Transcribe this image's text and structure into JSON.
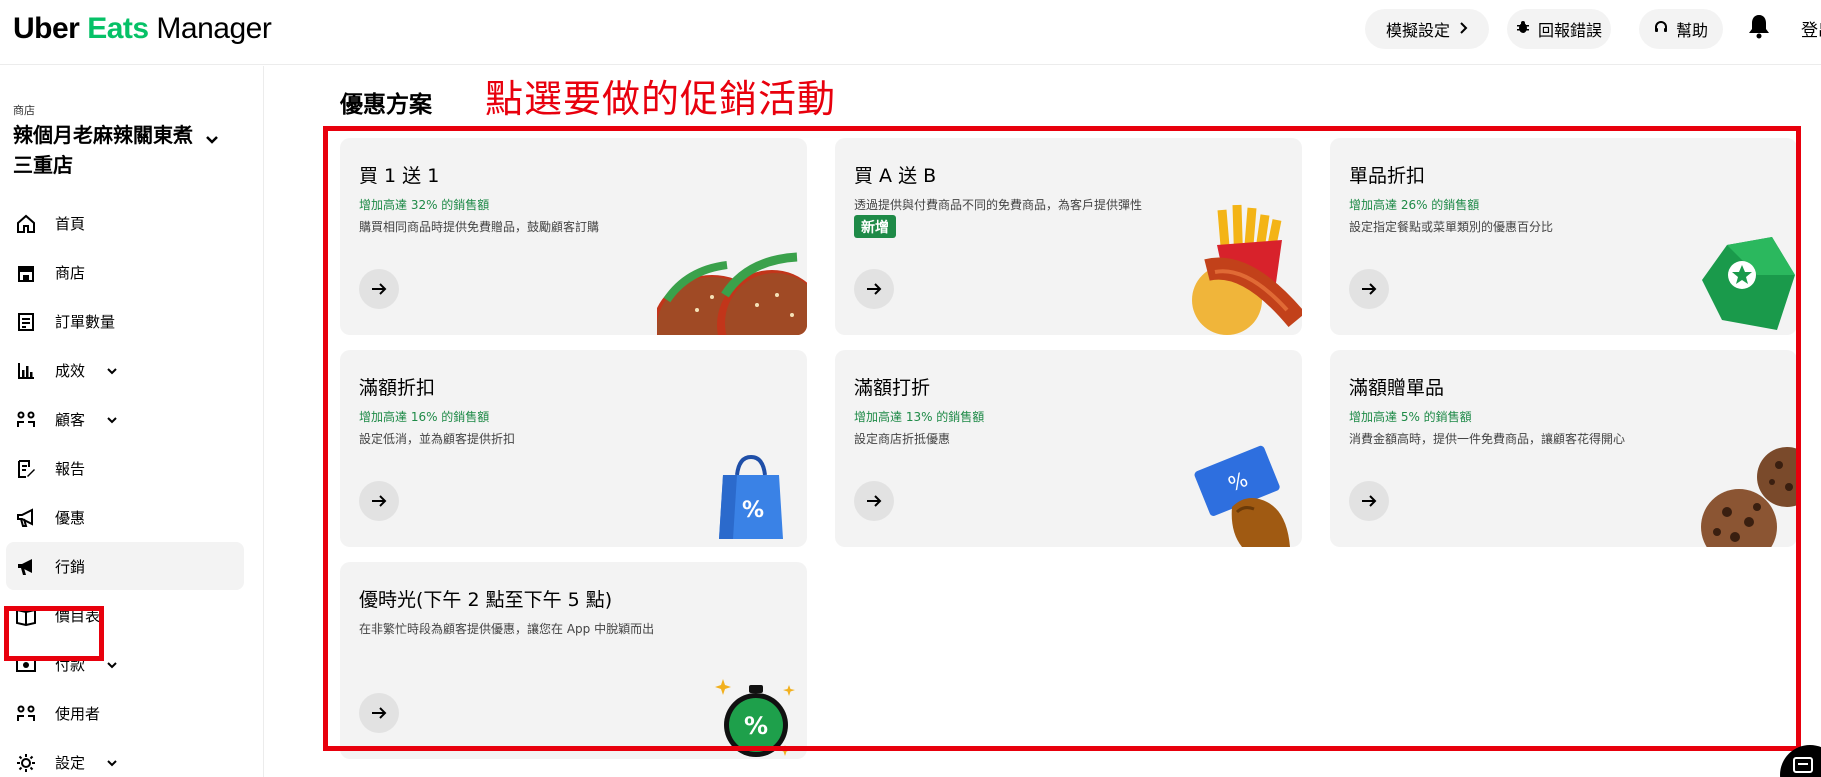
{
  "header": {
    "logo": {
      "uber": "Uber",
      "eats": "Eats",
      "manager": "Manager"
    },
    "simulate_label": "模擬設定",
    "report_bug_label": "回報錯誤",
    "help_label": "幫助",
    "logout_label": "登出"
  },
  "sidebar": {
    "store_label": "商店",
    "store_name": "辣個月老麻辣關東煮 三重店",
    "items": [
      {
        "label": "首頁",
        "icon": "home-icon"
      },
      {
        "label": "商店",
        "icon": "store-icon"
      },
      {
        "label": "訂單數量",
        "icon": "orders-icon"
      },
      {
        "label": "成效",
        "icon": "bar-chart-icon"
      },
      {
        "label": "顧客",
        "icon": "customers-icon"
      },
      {
        "label": "報告",
        "icon": "report-icon"
      },
      {
        "label": "優惠",
        "icon": "megaphone-icon"
      },
      {
        "label": "行銷",
        "icon": "megaphone-filled-icon"
      },
      {
        "label": "價目表",
        "icon": "book-icon"
      },
      {
        "label": "付款",
        "icon": "payment-icon"
      },
      {
        "label": "使用者",
        "icon": "users-icon"
      },
      {
        "label": "設定",
        "icon": "gear-icon"
      }
    ]
  },
  "main": {
    "title": "優惠方案",
    "annotation": "點選要做的促銷活動",
    "cards": [
      {
        "title": "買 1 送 1",
        "subtitle": "增加高達 32% 的銷售額",
        "desc": "購買相同商品時提供免費贈品，鼓勵顧客訂購",
        "art": "burger"
      },
      {
        "title": "買 A 送 B",
        "desc": "透過提供與付費商品不同的免費商品，為客戶提供彈性",
        "badge": "新增",
        "art": "hotdog"
      },
      {
        "title": "單品折扣",
        "subtitle": "增加高達 26% 的銷售額",
        "desc": "設定指定餐點或菜單類別的優惠百分比",
        "art": "tag"
      },
      {
        "title": "滿額折扣",
        "subtitle": "增加高達 16% 的銷售額",
        "desc": "設定低消，並為顧客提供折扣",
        "art": "bag"
      },
      {
        "title": "滿額打折",
        "subtitle": "增加高達 13% 的銷售額",
        "desc": "設定商店折抵優惠",
        "art": "card"
      },
      {
        "title": "滿額贈單品",
        "subtitle": "增加高達 5% 的銷售額",
        "desc": "消費金額高時，提供一件免費商品，讓顧客花得開心",
        "art": "cookies"
      },
      {
        "title": "優時光(下午 2 點至下午 5 點)",
        "desc": "在非繁忙時段為顧客提供優惠，讓您在 App 中脫穎而出",
        "art": "stopwatch"
      }
    ]
  },
  "colors": {
    "brand_green": "#06c167",
    "subtitle_green": "#1e8a47",
    "annotation_red": "#e8000d",
    "card_bg": "#f3f3f3"
  }
}
